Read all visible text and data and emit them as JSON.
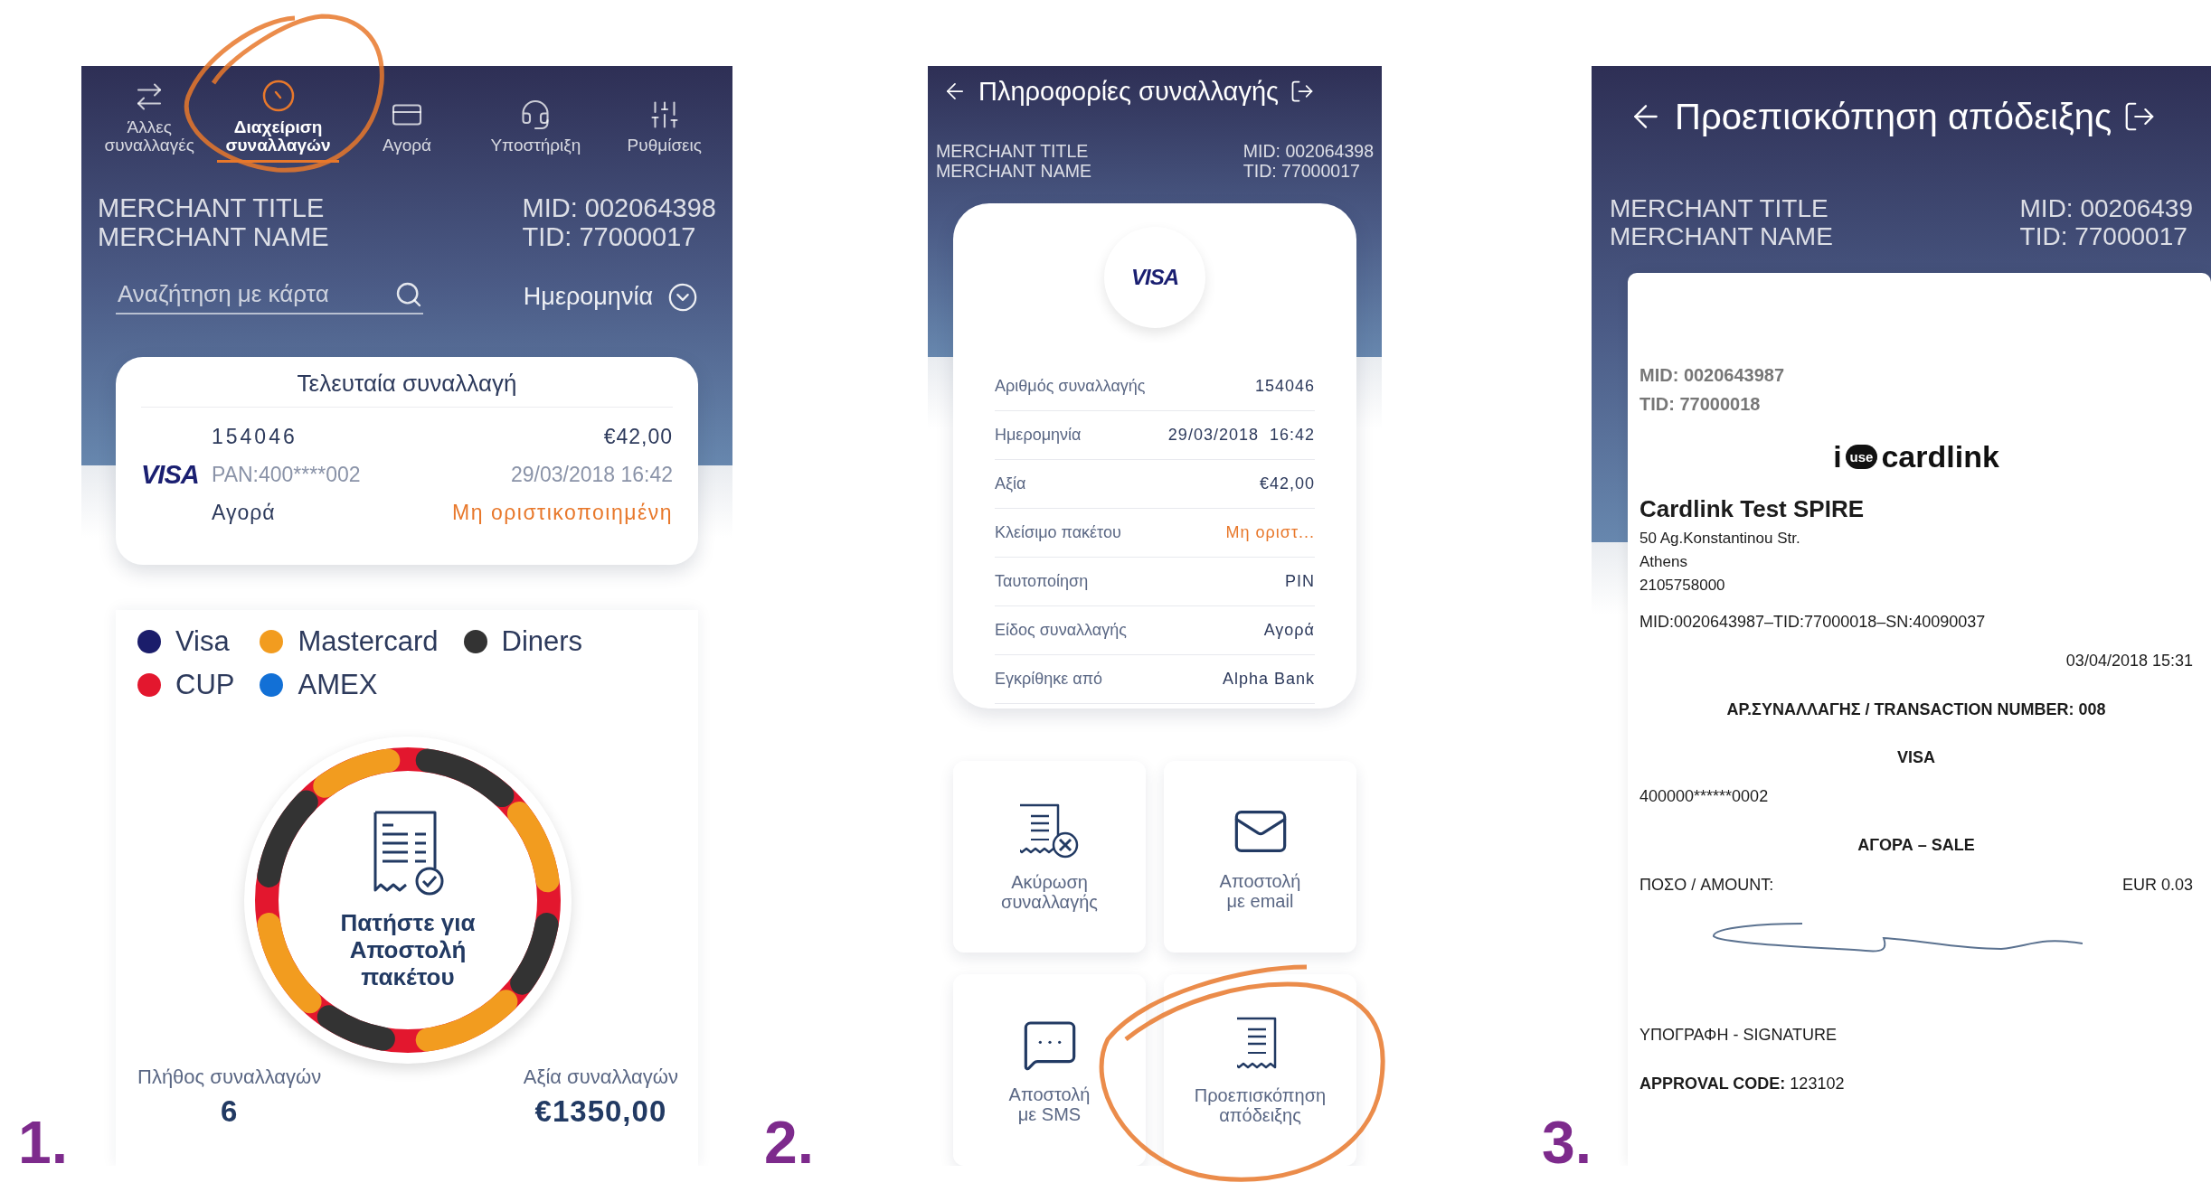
{
  "screen_1": {
    "step": "1.",
    "nav": [
      {
        "label": "Άλλες συναλλαγές",
        "kind": "other",
        "selected": false
      },
      {
        "label": "Διαχείριση συναλλαγών",
        "kind": "manage",
        "selected": true
      },
      {
        "label": "Αγορά",
        "kind": "purchase",
        "selected": false
      },
      {
        "label": "Υποστήριξη",
        "kind": "support",
        "selected": false
      },
      {
        "label": "Ρυθμίσεις",
        "kind": "settings",
        "selected": false
      }
    ],
    "merchant": {
      "title": "MERCHANT TITLE",
      "name": "MERCHANT NAME",
      "mid": "MID: 002064398",
      "tid": "TID: 77000017"
    },
    "search": {
      "placeholder": "Αναζήτηση με κάρτα"
    },
    "date_filter": "Ημερομηνία",
    "last_transaction": {
      "title": "Τελευταία συναλλαγή",
      "brand": "VISA",
      "number": "154046",
      "amount": "€42,00",
      "pan": "PAN:400****002",
      "datetime": "29/03/2018 16:42",
      "type": "Αγορά",
      "status": "Μη οριστικοποιημένη",
      "warning": true
    },
    "legend": [
      {
        "label": "Visa",
        "color": "#1b1d6b"
      },
      {
        "label": "Mastercard",
        "color": "#f29c1f"
      },
      {
        "label": "Diners",
        "color": "#333333"
      },
      {
        "label": "CUP",
        "color": "#e3172e"
      },
      {
        "label": "AMEX",
        "color": "#1270d6"
      }
    ],
    "package_button": "Πατήστε για Αποστολή πακέτου",
    "count_label": "Πλήθος συναλλαγών",
    "count": "6",
    "value_label": "Αξία συναλλαγών",
    "value": "€1350,00"
  },
  "screen_2": {
    "step": "2.",
    "title": "Πληροφορίες συναλλαγής",
    "merchant": {
      "title": "MERCHANT TITLE",
      "name": "MERCHANT NAME",
      "mid": "MID: 002064398",
      "tid": "TID: 77000017"
    },
    "brand": "VISA",
    "details": [
      {
        "label": "Αριθμός συναλλαγής",
        "value": "154046",
        "warning": false
      },
      {
        "label": "Ημερομηνία",
        "value": "29/03/2018  16:42",
        "warning": false
      },
      {
        "label": "Αξία",
        "value": "€42,00",
        "warning": false
      },
      {
        "label": "Κλείσιμο πακέτου",
        "value": "Μη οριστ...",
        "warning": true
      },
      {
        "label": "Ταυτοποίηση",
        "value": "PIN",
        "warning": false
      },
      {
        "label": "Είδος συναλλαγής",
        "value": "Αγορά",
        "warning": false
      },
      {
        "label": "Εγκρίθηκε από",
        "value": "Alpha Bank",
        "warning": false
      }
    ],
    "actions": [
      {
        "label": "Ακύρωση\nσυναλλαγής",
        "kind": "cancel"
      },
      {
        "label": "Αποστολή\nμε email",
        "kind": "email"
      },
      {
        "label": "Αποστολή\nμε SMS",
        "kind": "sms"
      },
      {
        "label": "Προεπισκόπηση\nαπόδειξης",
        "kind": "preview"
      }
    ]
  },
  "screen_3": {
    "step": "3.",
    "title": "Προεπισκόπηση απόδειξης",
    "merchant": {
      "title": "MERCHANT TITLE",
      "name": "MERCHANT NAME",
      "mid": "MID: 00206439",
      "tid": "TID: 77000017"
    },
    "receipt": [
      {
        "kind": "terminal",
        "text": "MID: 0020643987"
      },
      {
        "kind": "terminal",
        "text": "TID: 77000018"
      },
      {
        "kind": "logo",
        "prefix": "i",
        "badge": "use",
        "text": "cardlink"
      },
      {
        "kind": "store",
        "text": "Cardlink Test SPIRE"
      },
      {
        "kind": "address",
        "text": "50 Ag.Konstantinou Str."
      },
      {
        "kind": "address",
        "text": "Athens"
      },
      {
        "kind": "address",
        "text": "2105758000"
      },
      {
        "kind": "ids",
        "text": "MID:0020643987–TID:77000018–SN:40090037"
      },
      {
        "kind": "date",
        "text": "03/04/2018 15:31"
      },
      {
        "kind": "heading",
        "text": "ΑΡ.ΣΥΝΑΛΛΑΓΗΣ / TRANSACTION NUMBER: 008"
      },
      {
        "kind": "heading",
        "text": "VISA"
      },
      {
        "kind": "pan",
        "text": "400000******0002"
      },
      {
        "kind": "heading",
        "text": "ΑΓΟΡΑ – SALE"
      },
      {
        "kind": "amount",
        "text": "ΠΟΣΟ / AMOUNT:",
        "value": "EUR 0.03"
      },
      {
        "kind": "signature"
      },
      {
        "kind": "signature-label",
        "text": "ΥΠΟΓΡΑΦΗ - SIGNATURE"
      },
      {
        "kind": "approval",
        "text": "**APPROVAL CODE:**  123102"
      }
    ]
  }
}
